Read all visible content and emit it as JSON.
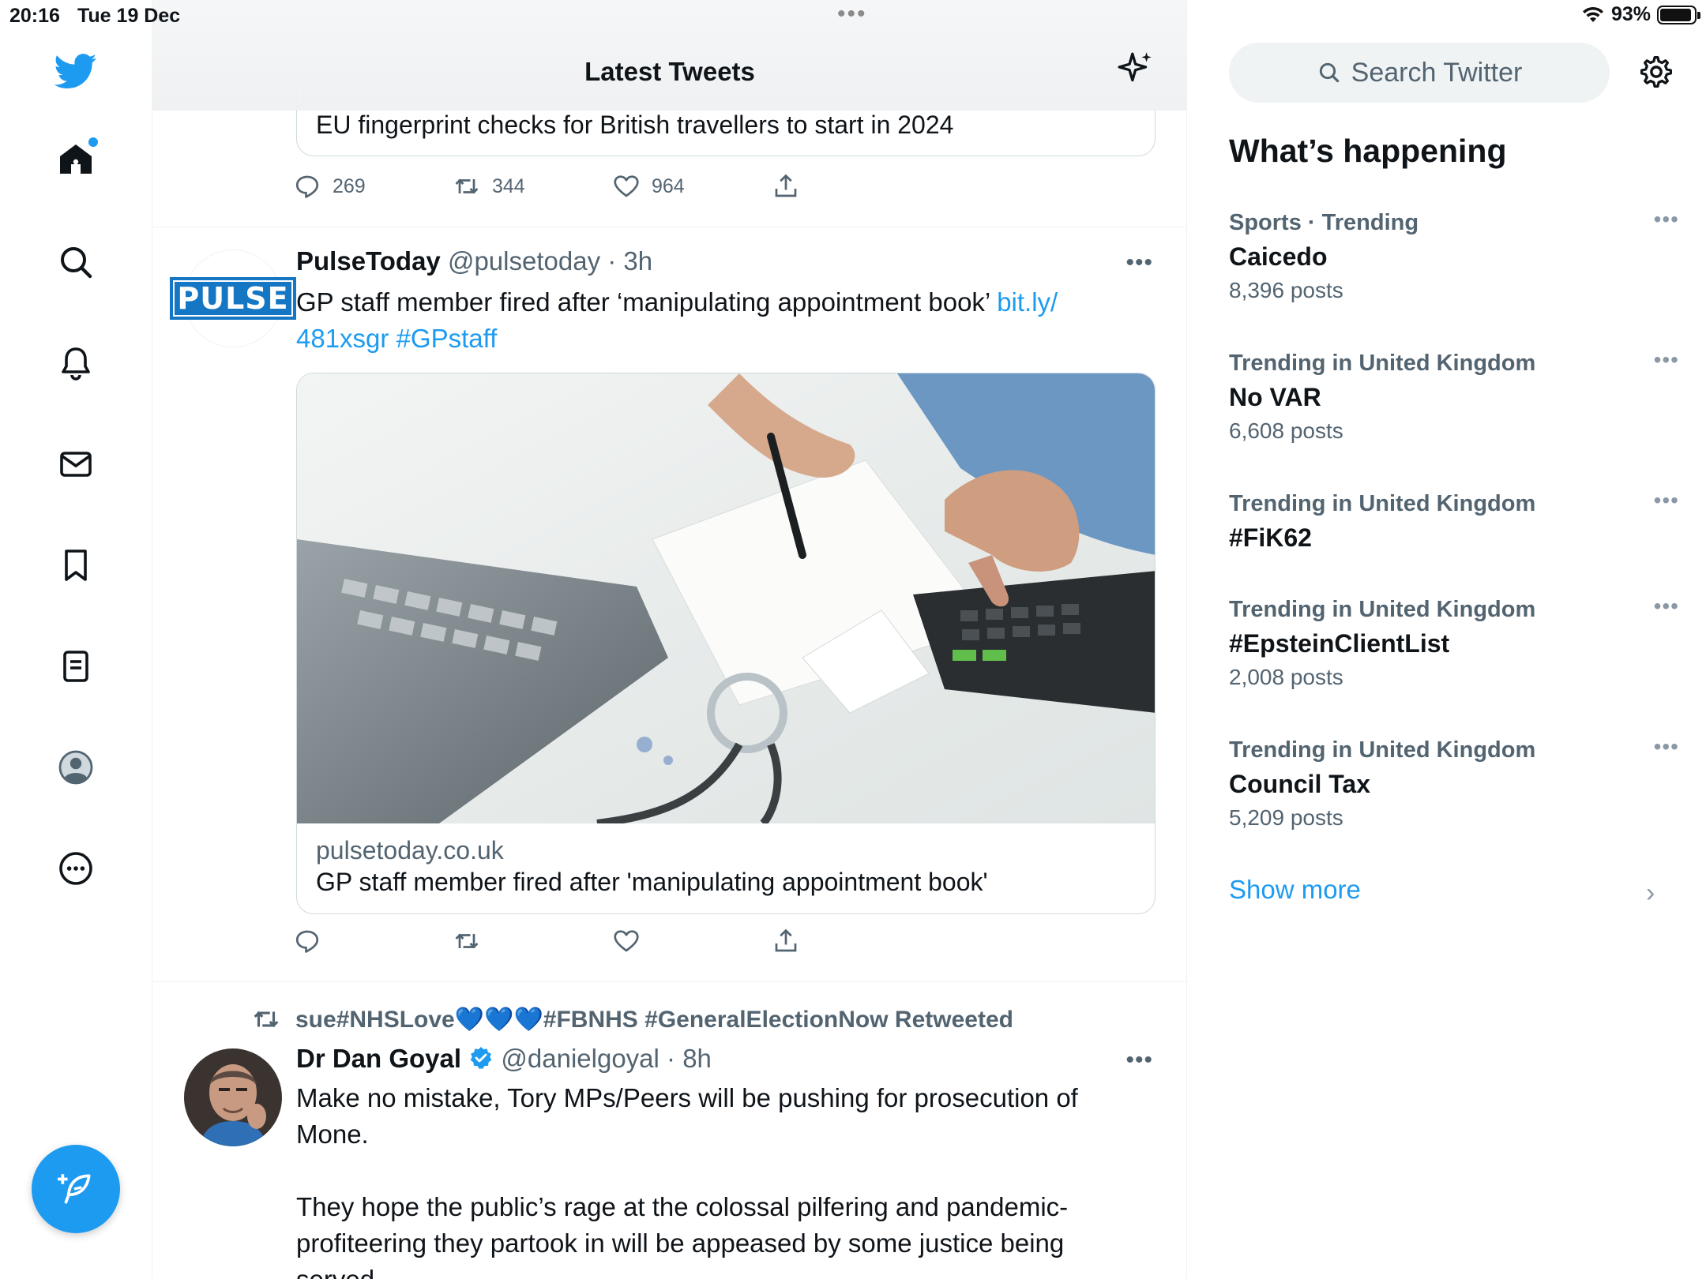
{
  "status_bar": {
    "time": "20:16",
    "date": "Tue 19 Dec",
    "battery": "93%",
    "battery_level": 0.93
  },
  "colors": {
    "brand": "#1d9bf0",
    "text_primary": "#0f1419",
    "text_secondary": "#536471",
    "border": "#cfd9de"
  },
  "nav": {
    "items": [
      {
        "icon": "home-icon",
        "label": "Home"
      },
      {
        "icon": "search-icon",
        "label": "Explore"
      },
      {
        "icon": "bell-icon",
        "label": "Notifications"
      },
      {
        "icon": "mail-icon",
        "label": "Messages"
      },
      {
        "icon": "bookmark-icon",
        "label": "Bookmarks"
      },
      {
        "icon": "list-icon",
        "label": "Lists"
      },
      {
        "icon": "profile-icon",
        "label": "Profile"
      },
      {
        "icon": "more-circle-icon",
        "label": "More"
      }
    ]
  },
  "header": {
    "title": "Latest Tweets"
  },
  "tweets": [
    {
      "card_title": "EU fingerprint checks for British travellers to start in 2024",
      "replies": "269",
      "retweets": "344",
      "likes": "964"
    },
    {
      "name": "PulseToday",
      "handle": "@pulsetoday",
      "sep": " · ",
      "time": "3h",
      "avatar_text": "PULSE",
      "text": "GP staff member fired after ‘manipulating appointment book’ ",
      "link1": "bit.ly/",
      "link2": "481xsgr",
      "hashtag": "#GPstaff",
      "card_domain": "pulsetoday.co.uk",
      "card_title": "GP staff member fired after 'manipulating appointment book'"
    },
    {
      "retweeted_by": "sue#NHSLove💙💙💙#FBNHS #GeneralElectionNow Retweeted",
      "name": "Dr Dan Goyal",
      "handle": "@danielgoyal",
      "sep": " · ",
      "time": "8h",
      "text_line1": "Make no mistake, Tory MPs/Peers will be pushing for prosecution of",
      "text_line2": "Mone.",
      "text_line3": "They hope the public’s rage at the colossal pilfering and pandemic-",
      "text_line4": "profiteering they partook in will be appeased by some justice being",
      "text_line5": "served..."
    }
  ],
  "sidebar": {
    "search_placeholder": "Search Twitter",
    "title": "What’s happening",
    "trends": [
      {
        "context": "Sports · Trending",
        "name": "Caicedo",
        "count": "8,396 posts"
      },
      {
        "context": "Trending in United Kingdom",
        "name": "No VAR",
        "count": "6,608 posts"
      },
      {
        "context": "Trending in United Kingdom",
        "name": "#FiK62",
        "count": ""
      },
      {
        "context": "Trending in United Kingdom",
        "name": "#EpsteinClientList",
        "count": "2,008 posts"
      },
      {
        "context": "Trending in United Kingdom",
        "name": "Council Tax",
        "count": "5,209 posts"
      }
    ],
    "show_more": "Show more"
  }
}
